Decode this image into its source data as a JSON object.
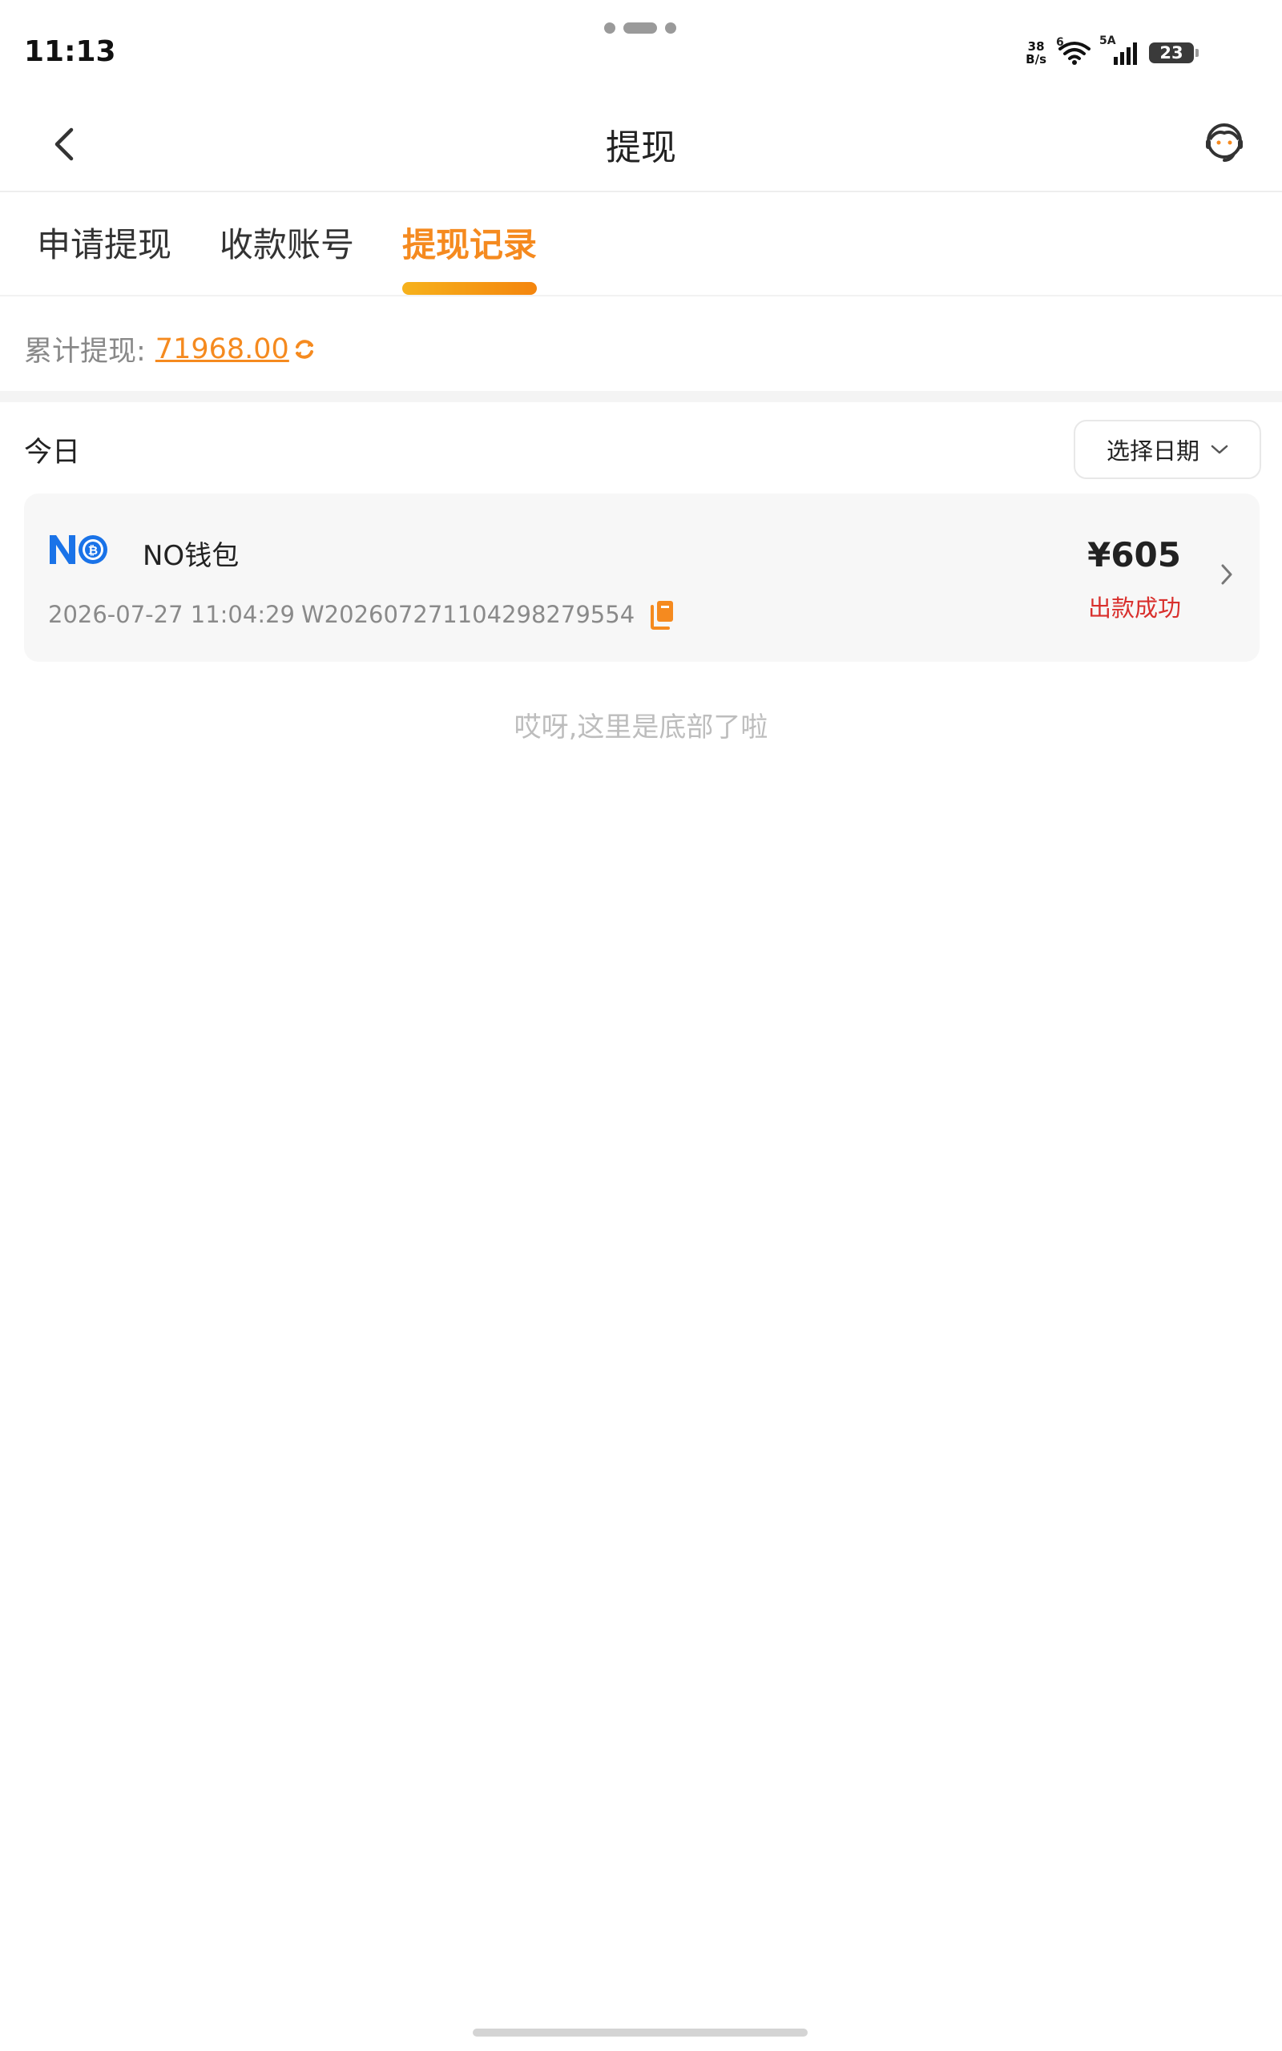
{
  "status_bar": {
    "time": "11:13",
    "net_speed_value": "38",
    "net_speed_unit": "B/s",
    "wifi_badge": "6",
    "signal_badge": "5A",
    "battery": "23"
  },
  "nav": {
    "title": "提现",
    "back_icon": "chevron-left-icon",
    "service_icon": "customer-service-icon"
  },
  "tabs": [
    {
      "label": "申请提现",
      "active": false
    },
    {
      "label": "收款账号",
      "active": false
    },
    {
      "label": "提现记录",
      "active": true
    }
  ],
  "total": {
    "label": "累计提现:",
    "value": "71968.00"
  },
  "filter": {
    "today_label": "今日",
    "date_picker_label": "选择日期"
  },
  "records": [
    {
      "wallet_name": "NO钱包",
      "datetime": "2026-07-27 11:04:29",
      "order_no": "W20260727110429827955​4",
      "amount": "¥605",
      "status": "出款成功"
    }
  ],
  "bottom_hint": "哎呀,这里是底部了啦",
  "colors": {
    "accent": "#f58a1f",
    "status_success": "#d9302d",
    "wallet_blue": "#1a73e8"
  }
}
